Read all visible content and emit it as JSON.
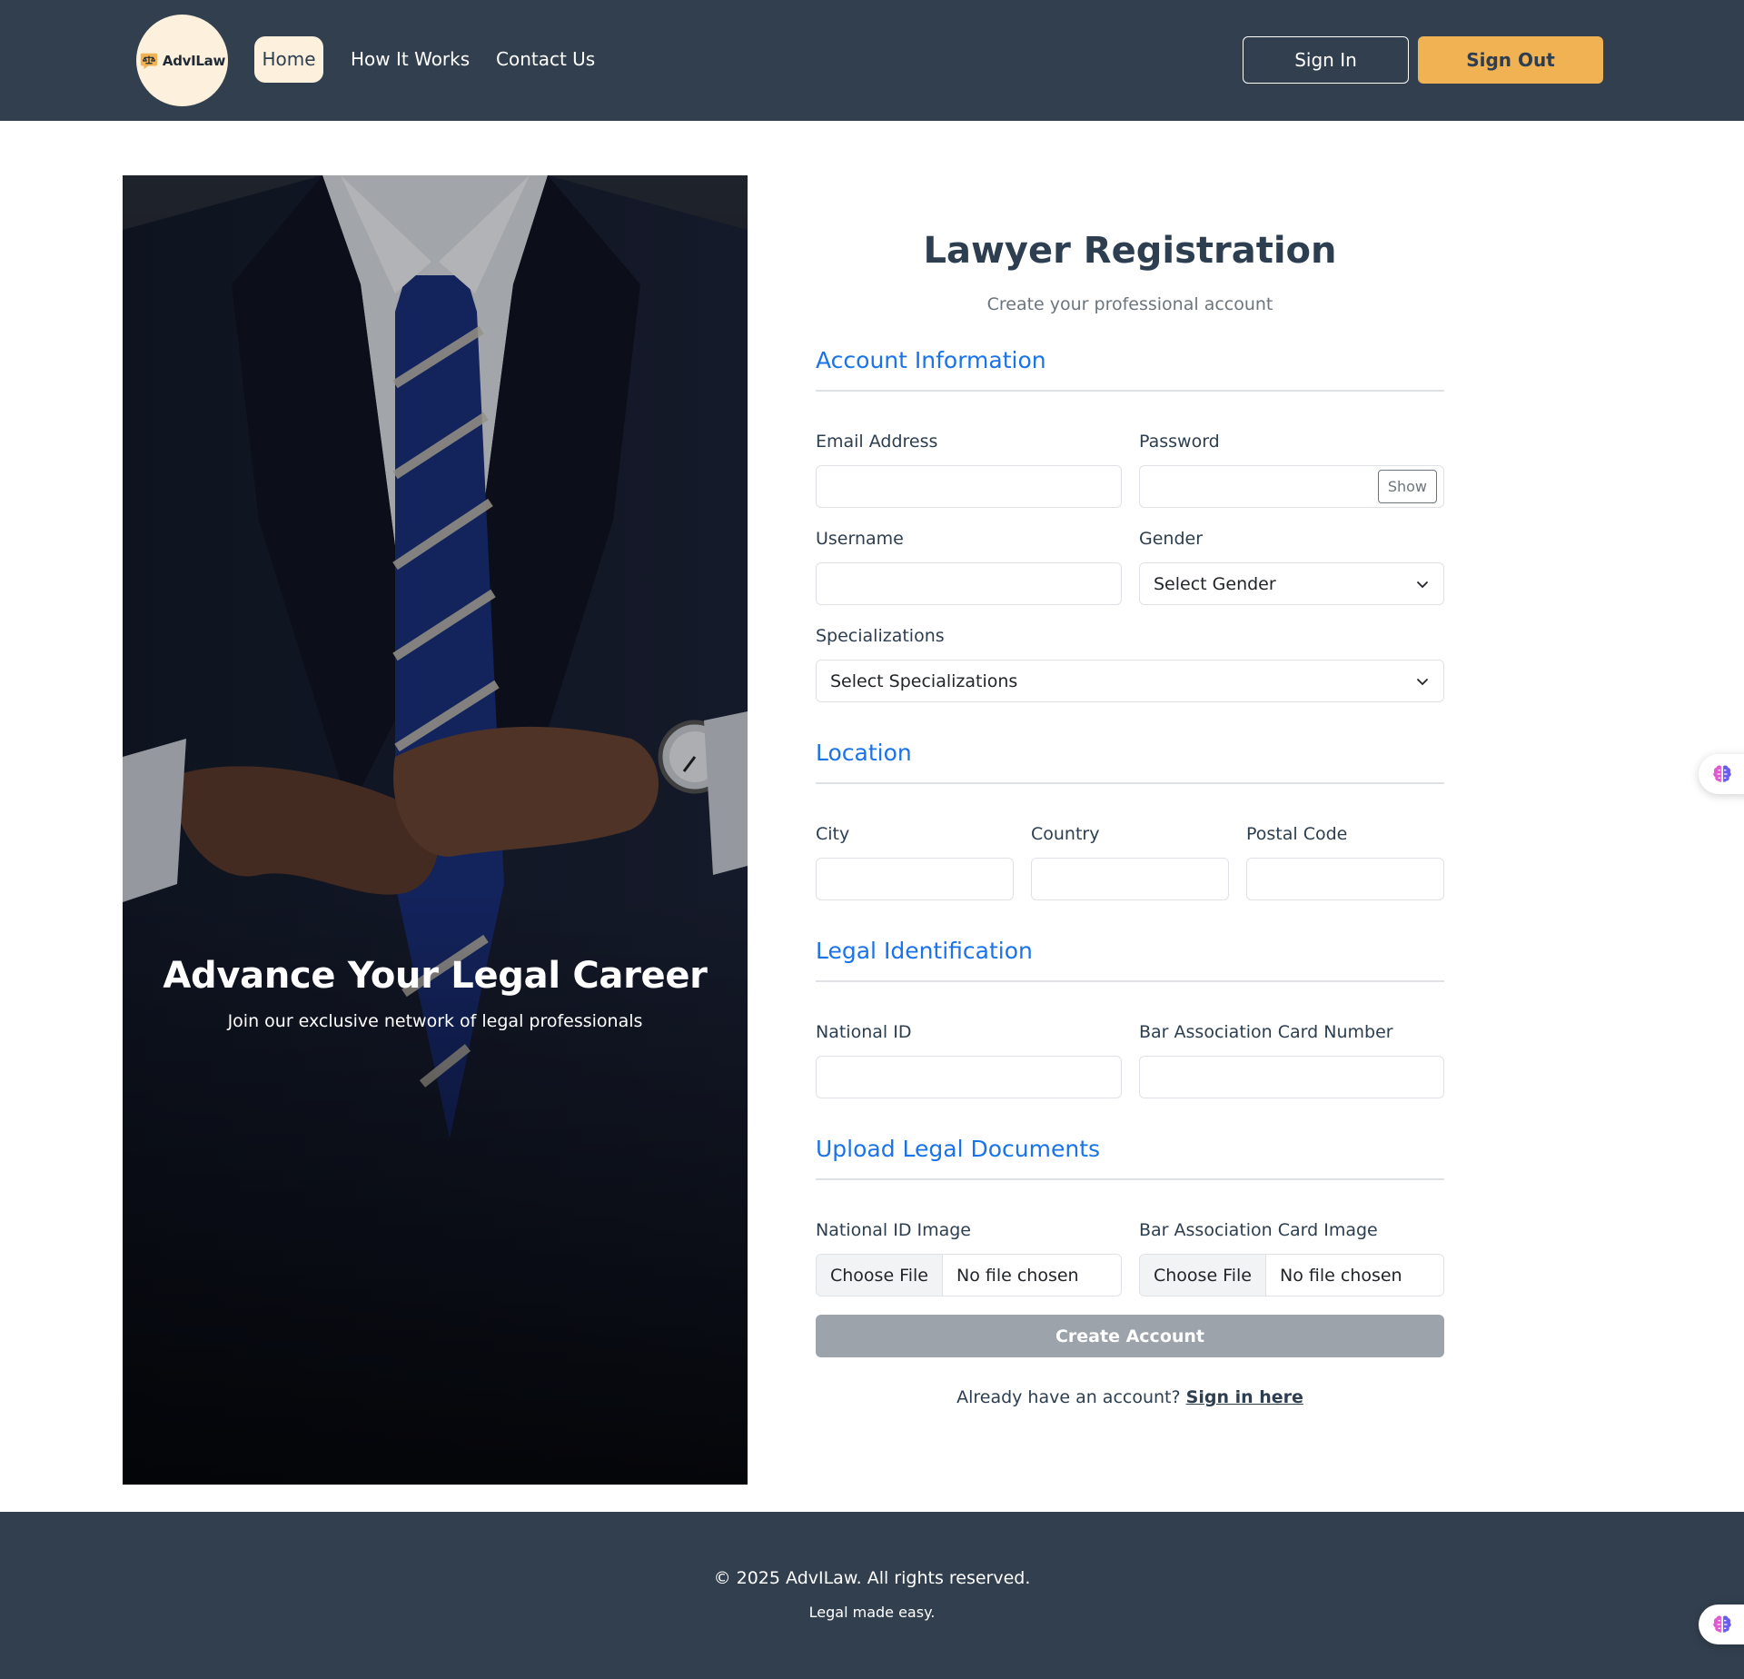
{
  "nav": {
    "logo_text": "AdvILaw",
    "links": [
      "Home",
      "How It Works",
      "Contact Us"
    ],
    "signin_label": "Sign In",
    "signout_label": "Sign Out"
  },
  "hero": {
    "title": "Advance Your Legal Career",
    "subtitle": "Join our exclusive network of legal professionals"
  },
  "form": {
    "title": "Lawyer Registration",
    "subtitle": "Create your professional account",
    "sections": {
      "account": "Account Information",
      "location": "Location",
      "legal_id": "Legal Identification",
      "documents": "Upload Legal Documents"
    },
    "fields": {
      "email_label": "Email Address",
      "password_label": "Password",
      "password_toggle": "Show",
      "username_label": "Username",
      "gender_label": "Gender",
      "gender_value": "Select Gender",
      "specializations_label": "Specializations",
      "specializations_value": "Select Specializations",
      "city_label": "City",
      "country_label": "Country",
      "postal_label": "Postal Code",
      "national_id_label": "National ID",
      "bar_card_label": "Bar Association Card Number",
      "national_id_image_label": "National ID Image",
      "bar_card_image_label": "Bar Association Card Image",
      "file_button": "Choose File",
      "file_status": "No file chosen"
    },
    "submit_label": "Create Account",
    "signin_prompt": "Already have an account?",
    "signin_link": "Sign in here"
  },
  "footer": {
    "copyright": "© 2025 AdvILaw. All rights reserved.",
    "tagline": "Legal made easy."
  },
  "colors": {
    "navbar": "#323f4e",
    "accent": "#f0b253",
    "section_title": "#1a73e8",
    "button_disabled": "#9ca3ab"
  },
  "icons": [
    "scales-logo-icon",
    "chevron-down-icon",
    "brain-icon"
  ]
}
